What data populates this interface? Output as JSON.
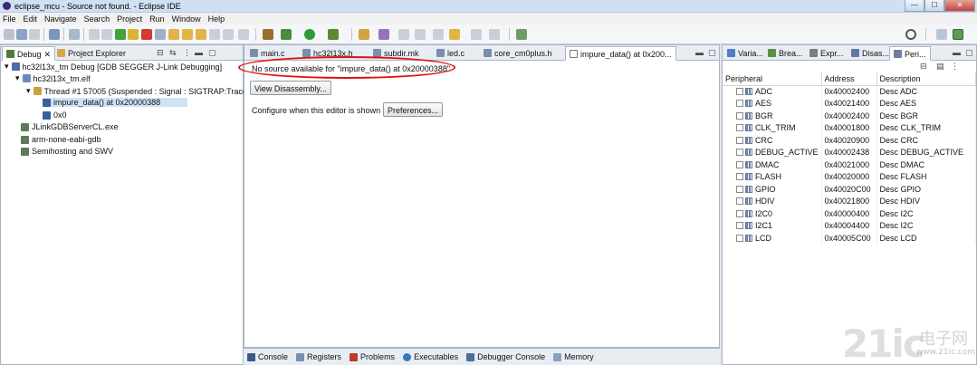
{
  "window": {
    "title": "eclipse_mcu - Source not found. - Eclipse IDE",
    "controls": {
      "minimize": "—",
      "maximize": "☐",
      "close": "✕"
    }
  },
  "menu": [
    {
      "label": "File"
    },
    {
      "label": "Edit"
    },
    {
      "label": "Navigate"
    },
    {
      "label": "Search"
    },
    {
      "label": "Project"
    },
    {
      "label": "Run"
    },
    {
      "label": "Window"
    },
    {
      "label": "Help"
    }
  ],
  "debug_view": {
    "tabs": [
      {
        "label": "Debug",
        "icon": "debug-icon",
        "close": "✕"
      },
      {
        "label": "Project Explorer",
        "icon": "project-explorer-icon"
      }
    ],
    "tree": [
      {
        "label": "hc32l13x_tm Debug [GDB SEGGER J-Link Debugging]",
        "icon": "launch-config-icon",
        "depth": 0,
        "expander": "▾"
      },
      {
        "label": "hc32l13x_tm.elf",
        "icon": "elf-file-icon",
        "depth": 1,
        "expander": "▾"
      },
      {
        "label": "Thread #1 57005 (Suspended : Signal : SIGTRAP:Trace/",
        "icon": "thread-icon",
        "depth": 2,
        "expander": "▾"
      },
      {
        "label": "impure_data() at 0x20000388",
        "icon": "stack-frame-icon",
        "depth": 3,
        "expander": "",
        "selected": true
      },
      {
        "label": "0x0",
        "icon": "stack-frame-icon",
        "depth": 3,
        "expander": ""
      },
      {
        "label": "JLinkGDBServerCL.exe",
        "icon": "process-icon",
        "depth": 1,
        "expander": ""
      },
      {
        "label": "arm-none-eabi-gdb",
        "icon": "process-icon",
        "depth": 1,
        "expander": ""
      },
      {
        "label": "Semihosting and SWV",
        "icon": "process-icon",
        "depth": 1,
        "expander": ""
      }
    ]
  },
  "editor": {
    "tabs": [
      {
        "label": "main.c"
      },
      {
        "label": "hc32l13x.h"
      },
      {
        "label": "subdir.mk"
      },
      {
        "label": "led.c"
      },
      {
        "label": "core_cm0plus.h"
      },
      {
        "label": "impure_data() at 0x200..."
      }
    ],
    "message": "No source available for \"impure_data() at 0x20000388\"",
    "view_disassembly": "View Disassembly...",
    "configure_text": "Configure when this editor is shown",
    "preferences": "Preferences..."
  },
  "right_view": {
    "tabs": [
      {
        "label": "Varia..."
      },
      {
        "label": "Brea..."
      },
      {
        "label": "Expr..."
      },
      {
        "label": "Disas..."
      },
      {
        "label": "Peri..."
      }
    ],
    "columns": [
      "Peripheral",
      "Address",
      "Description"
    ],
    "rows": [
      {
        "name": "ADC",
        "address": "0x40002400",
        "desc": "Desc ADC"
      },
      {
        "name": "AES",
        "address": "0x40021400",
        "desc": "Desc AES"
      },
      {
        "name": "BGR",
        "address": "0x40002400",
        "desc": "Desc BGR"
      },
      {
        "name": "CLK_TRIM",
        "address": "0x40001800",
        "desc": "Desc CLK_TRIM"
      },
      {
        "name": "CRC",
        "address": "0x40020900",
        "desc": "Desc CRC"
      },
      {
        "name": "DEBUG_ACTIVE",
        "address": "0x40002438",
        "desc": "Desc DEBUG_ACTIVE"
      },
      {
        "name": "DMAC",
        "address": "0x40021000",
        "desc": "Desc DMAC"
      },
      {
        "name": "FLASH",
        "address": "0x40020000",
        "desc": "Desc FLASH"
      },
      {
        "name": "GPIO",
        "address": "0x40020C00",
        "desc": "Desc GPIO"
      },
      {
        "name": "HDIV",
        "address": "0x40021800",
        "desc": "Desc HDIV"
      },
      {
        "name": "I2C0",
        "address": "0x40000400",
        "desc": "Desc I2C"
      },
      {
        "name": "I2C1",
        "address": "0x40004400",
        "desc": "Desc I2C"
      },
      {
        "name": "LCD",
        "address": "0x40005C00",
        "desc": "Desc LCD"
      }
    ]
  },
  "bottom_tabs": [
    {
      "label": "Console"
    },
    {
      "label": "Registers"
    },
    {
      "label": "Problems"
    },
    {
      "label": "Executables"
    },
    {
      "label": "Debugger Console"
    },
    {
      "label": "Memory"
    }
  ],
  "watermark": {
    "big": "21ic",
    "cn": "电子网",
    "url": "www.21ic.com"
  }
}
